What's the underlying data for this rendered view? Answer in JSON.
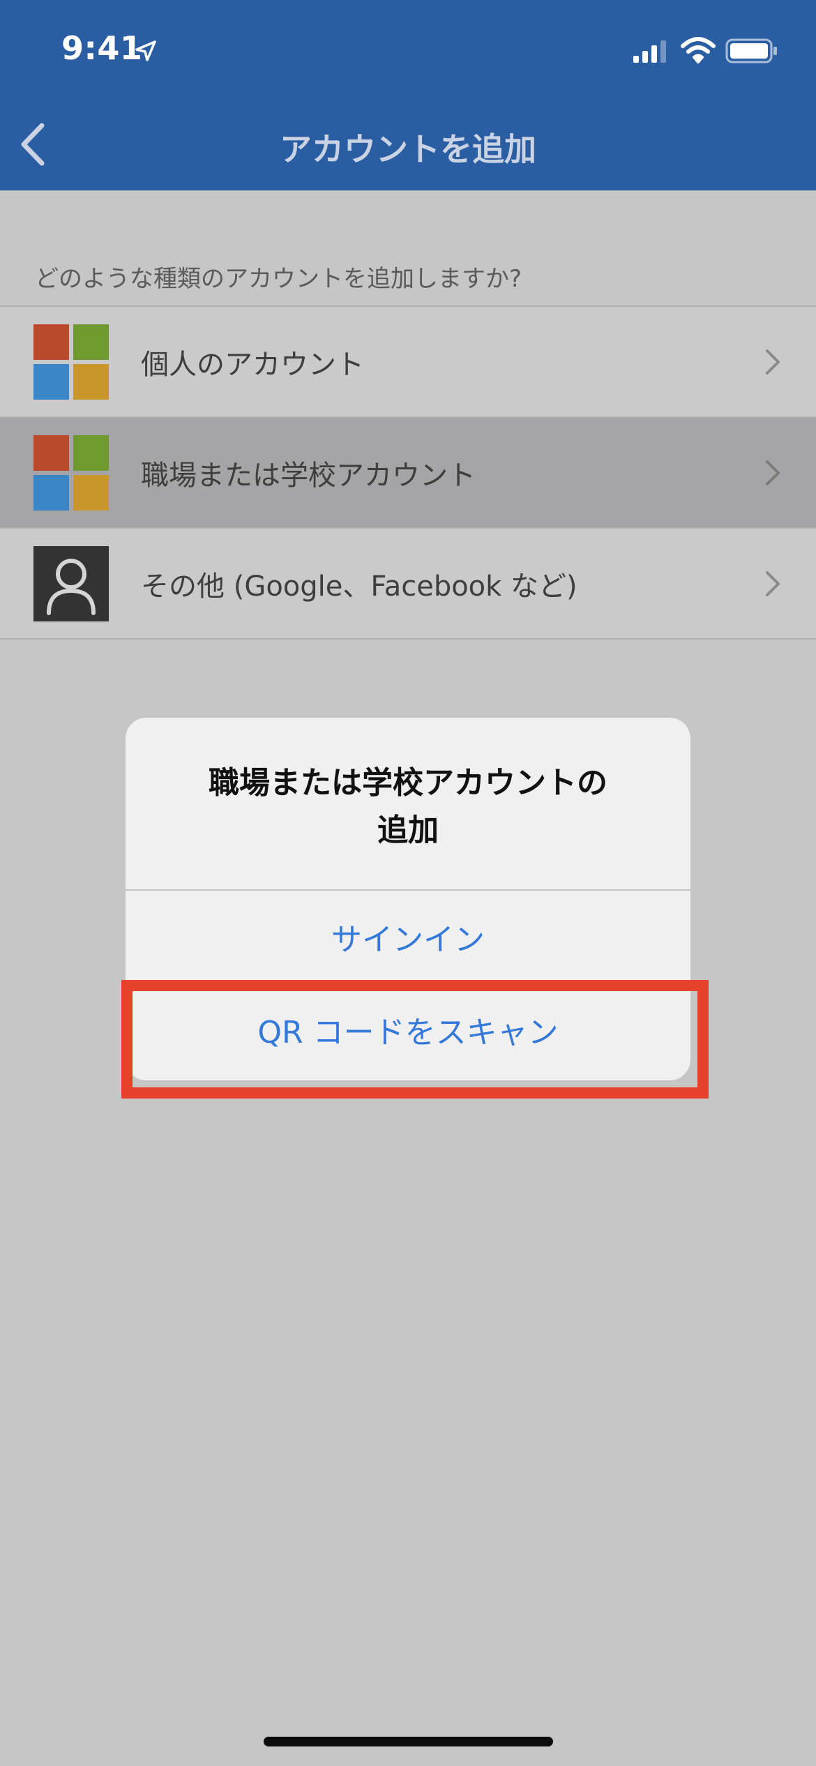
{
  "status_bar": {
    "time": "9:41"
  },
  "nav": {
    "title": "アカウントを追加"
  },
  "section": {
    "header": "どのような種類のアカウントを追加しますか?"
  },
  "account_types": [
    {
      "label": "個人のアカウント",
      "icon": "microsoft-logo-icon",
      "selected": false
    },
    {
      "label": "職場または学校アカウント",
      "icon": "microsoft-logo-icon",
      "selected": true
    },
    {
      "label": "その他 (Google、Facebook など)",
      "icon": "person-icon",
      "selected": false
    }
  ],
  "alert": {
    "title_line1": "職場または学校アカウントの",
    "title_line2": "追加",
    "sign_in": "サインイン",
    "scan_qr": "QR コードをスキャン"
  },
  "colors": {
    "nav_bar": "#2b5da3",
    "ms_red": "#b94a2b",
    "ms_green": "#6e9a2f",
    "ms_blue": "#3a86c7",
    "ms_yellow": "#c9962c",
    "alert_button_text": "#3478d9",
    "highlight": "#e8412b"
  }
}
